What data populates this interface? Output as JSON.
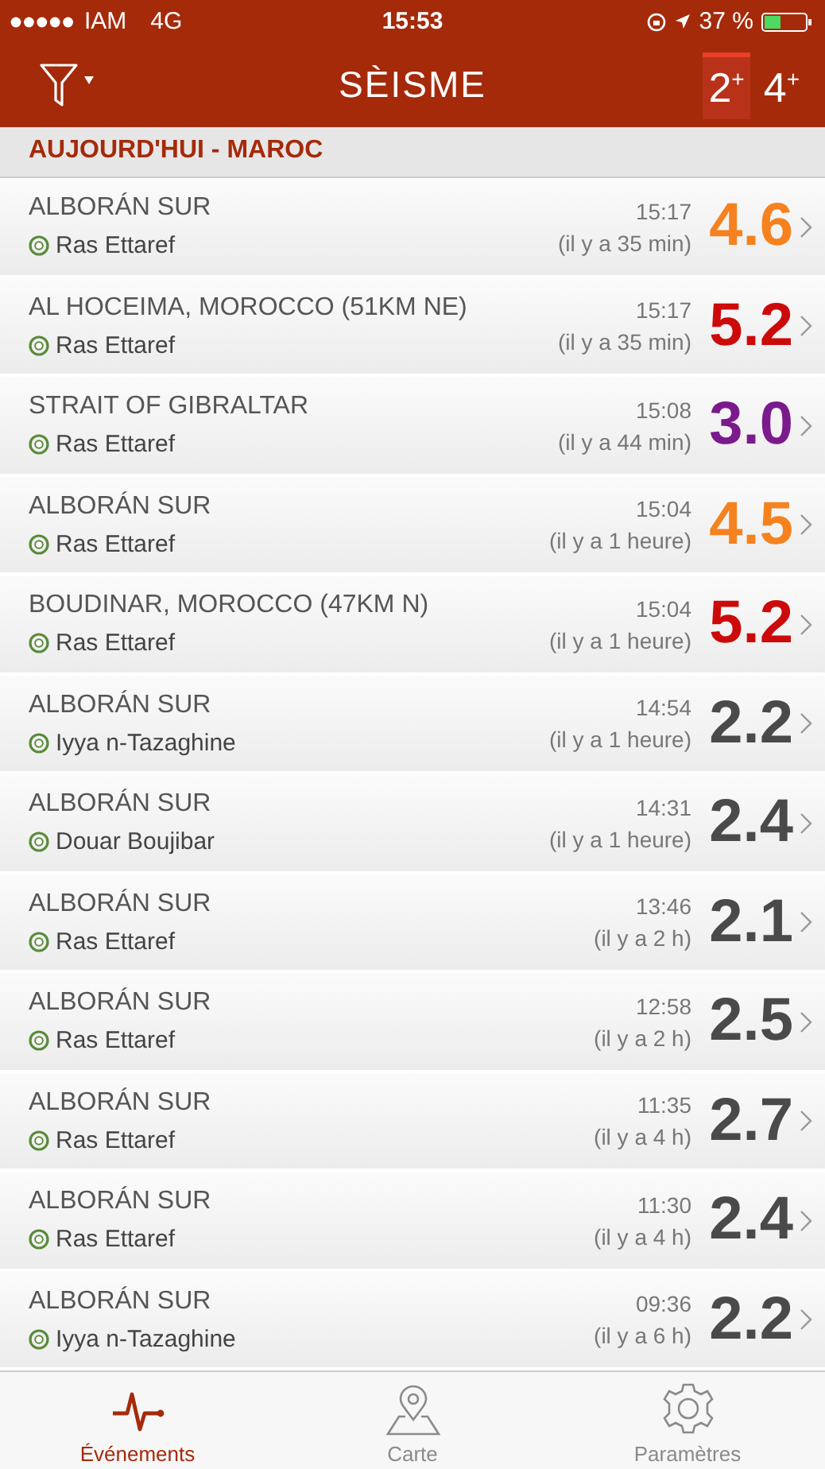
{
  "status_bar": {
    "carrier": "IAM",
    "network": "4G",
    "time": "15:53",
    "battery": "37 %"
  },
  "header": {
    "title": "SÈISME",
    "filters": [
      {
        "label": "2",
        "sup": "+",
        "selected": true
      },
      {
        "label": "4",
        "sup": "+",
        "selected": false
      }
    ]
  },
  "section": {
    "title": "AUJOURD'HUI - MAROC"
  },
  "events": [
    {
      "region": "ALBORÁN SUR",
      "place": "Ras Ettaref",
      "time": "15:17",
      "ago": "(il y a 35 min)",
      "magnitude": "4.6",
      "color": "#f5821f"
    },
    {
      "region": "AL HOCEIMA, MOROCCO (51KM NE)",
      "place": "Ras Ettaref",
      "time": "15:17",
      "ago": "(il y a 35 min)",
      "magnitude": "5.2",
      "color": "#cc0a0a"
    },
    {
      "region": "STRAIT OF GIBRALTAR",
      "place": "Ras Ettaref",
      "time": "15:08",
      "ago": "(il y a 44 min)",
      "magnitude": "3.0",
      "color": "#7b1a8c"
    },
    {
      "region": "ALBORÁN SUR",
      "place": "Ras Ettaref",
      "time": "15:04",
      "ago": "(il y a 1 heure)",
      "magnitude": "4.5",
      "color": "#f5821f"
    },
    {
      "region": "BOUDINAR, MOROCCO (47KM N)",
      "place": "Ras Ettaref",
      "time": "15:04",
      "ago": "(il y a 1 heure)",
      "magnitude": "5.2",
      "color": "#cc0a0a"
    },
    {
      "region": "ALBORÁN SUR",
      "place": "Iyya n-Tazaghine",
      "time": "14:54",
      "ago": "(il y a 1 heure)",
      "magnitude": "2.2",
      "color": "#4a4a4a"
    },
    {
      "region": "ALBORÁN SUR",
      "place": "Douar Boujibar",
      "time": "14:31",
      "ago": "(il y a 1 heure)",
      "magnitude": "2.4",
      "color": "#4a4a4a"
    },
    {
      "region": "ALBORÁN SUR",
      "place": "Ras Ettaref",
      "time": "13:46",
      "ago": "(il y a 2 h)",
      "magnitude": "2.1",
      "color": "#4a4a4a"
    },
    {
      "region": "ALBORÁN SUR",
      "place": "Ras Ettaref",
      "time": "12:58",
      "ago": "(il y a 2 h)",
      "magnitude": "2.5",
      "color": "#4a4a4a"
    },
    {
      "region": "ALBORÁN SUR",
      "place": "Ras Ettaref",
      "time": "11:35",
      "ago": "(il y a 4 h)",
      "magnitude": "2.7",
      "color": "#4a4a4a"
    },
    {
      "region": "ALBORÁN SUR",
      "place": "Ras Ettaref",
      "time": "11:30",
      "ago": "(il y a 4 h)",
      "magnitude": "2.4",
      "color": "#4a4a4a"
    },
    {
      "region": "ALBORÁN SUR",
      "place": "Iyya n-Tazaghine",
      "time": "09:36",
      "ago": "(il y a 6 h)",
      "magnitude": "2.2",
      "color": "#4a4a4a"
    }
  ],
  "tab_bar": [
    {
      "kind": "pulse",
      "label": "Événements",
      "selected": true
    },
    {
      "kind": "map",
      "label": "Carte",
      "selected": false
    },
    {
      "kind": "gear",
      "label": "Paramètres",
      "selected": false
    }
  ]
}
